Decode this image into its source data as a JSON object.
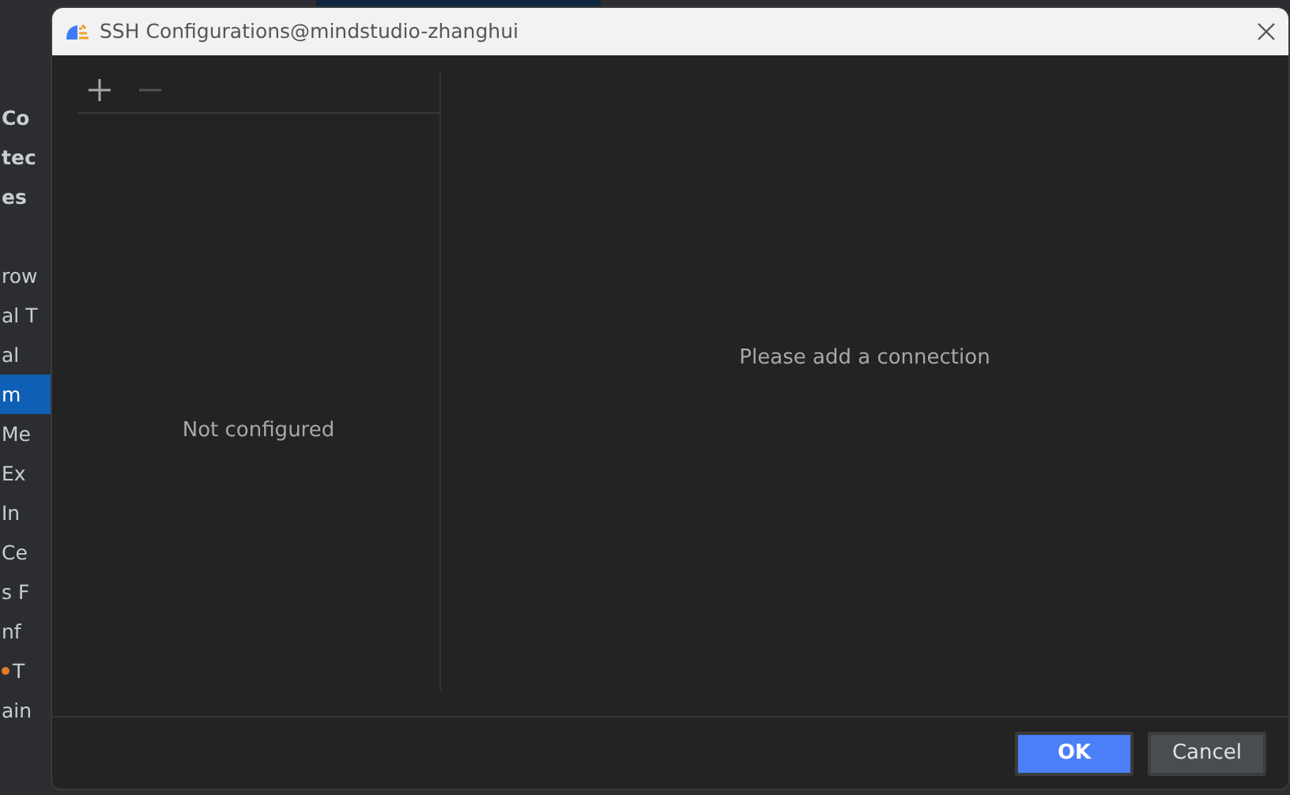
{
  "background_list": [
    {
      "label": "Co",
      "kind": "section",
      "selected": false
    },
    {
      "label": "tec",
      "kind": "section",
      "selected": false
    },
    {
      "label": "es",
      "kind": "section",
      "selected": false
    },
    {
      "label": "row",
      "kind": "item",
      "selected": false
    },
    {
      "label": "al T",
      "kind": "item",
      "selected": false
    },
    {
      "label": "al",
      "kind": "item",
      "selected": false
    },
    {
      "label": "m",
      "kind": "item",
      "selected": true
    },
    {
      "label": "Me",
      "kind": "item",
      "selected": false
    },
    {
      "label": "Ex",
      "kind": "item",
      "selected": false
    },
    {
      "label": "In",
      "kind": "item",
      "selected": false
    },
    {
      "label": "Ce",
      "kind": "item",
      "selected": false
    },
    {
      "label": "s F",
      "kind": "item",
      "selected": false
    },
    {
      "label": "nf",
      "kind": "item",
      "selected": false
    },
    {
      "label": "T",
      "kind": "marked",
      "selected": false
    },
    {
      "label": "ain",
      "kind": "item",
      "selected": false
    }
  ],
  "window": {
    "title": "SSH Configurations@mindstudio-zhanghui"
  },
  "toolbar": [
    {
      "kind": "add",
      "disabled": false
    },
    {
      "kind": "remove",
      "disabled": true
    }
  ],
  "list_panel": {
    "empty_text": "Not configured"
  },
  "detail_panel": {
    "empty_text": "Please add a connection"
  },
  "buttons": [
    {
      "label": "OK",
      "kind": "primary"
    },
    {
      "label": "Cancel",
      "kind": "secondary"
    }
  ]
}
